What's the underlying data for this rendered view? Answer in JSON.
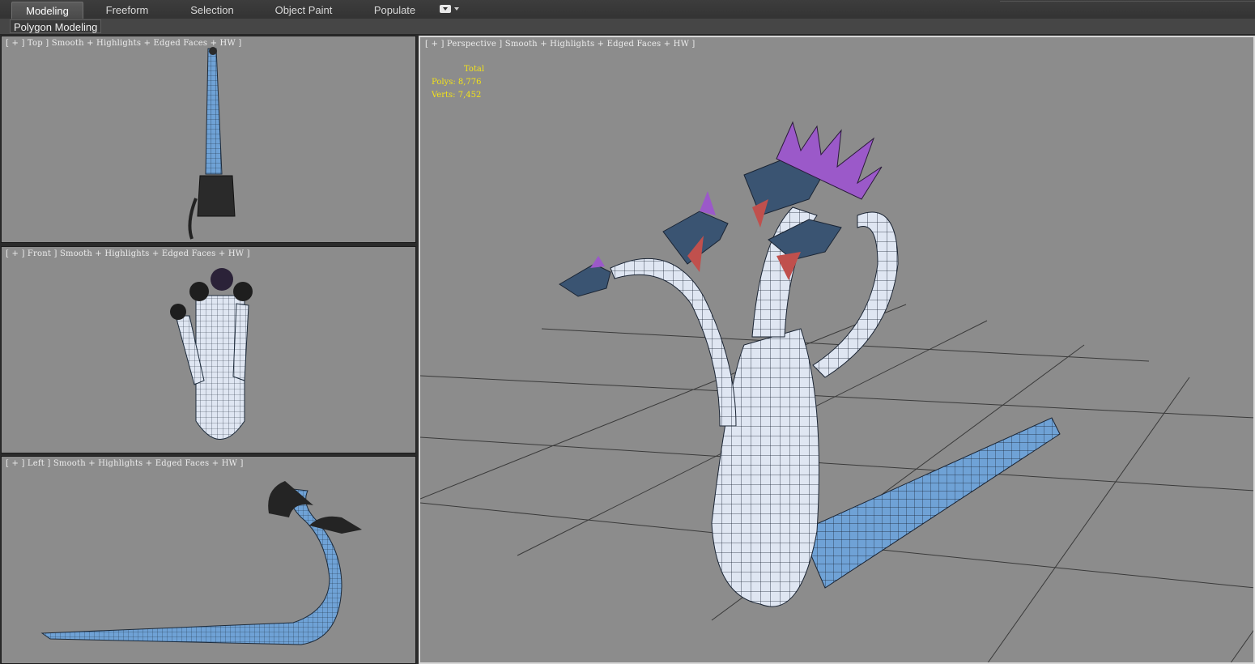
{
  "ribbon": {
    "tabs": [
      {
        "label": "Modeling",
        "active": true
      },
      {
        "label": "Freeform",
        "active": false
      },
      {
        "label": "Selection",
        "active": false
      },
      {
        "label": "Object Paint",
        "active": false
      },
      {
        "label": "Populate",
        "active": false
      }
    ],
    "extra_icon": "ribbon-options-icon",
    "panel_label": "Polygon Modeling"
  },
  "viewports": {
    "top": {
      "label": "[ + ] Top ] Smooth + Highlights + Edged Faces + HW ]"
    },
    "front": {
      "label": "[ + ] Front ] Smooth + Highlights + Edged Faces + HW ]"
    },
    "left": {
      "label": "[ + ] Left ] Smooth + Highlights + Edged Faces + HW ]"
    },
    "perspective": {
      "label": "[ + ] Perspective ] Smooth + Highlights + Edged Faces + HW ]",
      "stats": {
        "title": "Total",
        "polys": "Polys: 8,776",
        "verts": "Verts: 7,452"
      }
    }
  },
  "colors": {
    "viewport_bg": "#8c8c8c",
    "stats_text": "#f2e219",
    "model_body": "#6fa2d6",
    "model_belly": "#dfe6f2",
    "model_crest": "#9b59c9",
    "model_mouth": "#c0504d"
  }
}
